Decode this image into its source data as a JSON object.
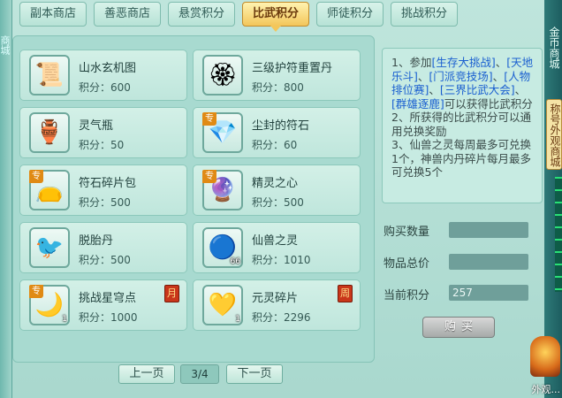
{
  "tabs": [
    {
      "label": "副本商店",
      "active": false
    },
    {
      "label": "善恶商店",
      "active": false
    },
    {
      "label": "悬赏积分",
      "active": false
    },
    {
      "label": "比武积分",
      "active": true
    },
    {
      "label": "师徒积分",
      "active": false
    },
    {
      "label": "挑战积分",
      "active": false
    }
  ],
  "side": {
    "left_text": "商城",
    "right_text": "金币商城",
    "right_tag": "称号外观商城",
    "right_bottom": "外观..."
  },
  "items": [
    {
      "name": "山水玄机图",
      "price": "积分：600",
      "icon": "scroll-icon",
      "glyph": "📜",
      "zhuan": false,
      "count": "",
      "limit": ""
    },
    {
      "name": "三级护符重置丹",
      "price": "积分：800",
      "icon": "talisman-pill-icon",
      "glyph": "🏵",
      "zhuan": false,
      "count": "",
      "limit": ""
    },
    {
      "name": "灵气瓶",
      "price": "积分：50",
      "icon": "bottle-icon",
      "glyph": "🏺",
      "zhuan": false,
      "count": "",
      "limit": ""
    },
    {
      "name": "尘封的符石",
      "price": "积分：60",
      "icon": "rune-stone-icon",
      "glyph": "💎",
      "zhuan": true,
      "zhuan_label": "专",
      "count": "",
      "limit": ""
    },
    {
      "name": "符石碎片包",
      "price": "积分：500",
      "icon": "fragment-bag-icon",
      "glyph": "👝",
      "zhuan": true,
      "zhuan_label": "专",
      "count": "",
      "limit": ""
    },
    {
      "name": "精灵之心",
      "price": "积分：500",
      "icon": "spirit-heart-icon",
      "glyph": "🔮",
      "zhuan": true,
      "zhuan_label": "专",
      "count": "",
      "limit": ""
    },
    {
      "name": "脱胎丹",
      "price": "积分：500",
      "icon": "elixir-icon",
      "glyph": "🐦",
      "zhuan": false,
      "count": "",
      "limit": ""
    },
    {
      "name": "仙兽之灵",
      "price": "积分：1010",
      "icon": "beast-spirit-icon",
      "glyph": "🔵",
      "zhuan": false,
      "count": "66",
      "limit": ""
    },
    {
      "name": "挑战星穹点",
      "price": "积分：1000",
      "icon": "star-moon-icon",
      "glyph": "🌙",
      "zhuan": true,
      "zhuan_label": "专",
      "count": "1",
      "limit": "月"
    },
    {
      "name": "元灵碎片",
      "price": "积分：2296",
      "icon": "spirit-shard-icon",
      "glyph": "💛",
      "zhuan": false,
      "count": "1",
      "limit": "周"
    }
  ],
  "pager": {
    "prev": "上一页",
    "page": "3/4",
    "next": "下一页"
  },
  "info": {
    "p1_prefix": "1、参加",
    "links": [
      "[生存大挑战]",
      "[天地乐斗]",
      "[门派竞技场]",
      "[人物排位赛]",
      "[三界比武大会]",
      "[群雄逐鹿]"
    ],
    "sep": "、",
    "p1_suffix": "可以获得比武积分",
    "p2": "2、所获得的比武积分可以通用兑换奖励",
    "p3": "3、仙兽之灵每周最多可兑换1个，神兽内丹碎片每月最多可兑换5个"
  },
  "form": {
    "qty_label": "购买数量",
    "qty_value": "",
    "total_label": "物品总价",
    "total_value": "",
    "points_label": "当前积分",
    "points_value": "257",
    "buy_label": "购买"
  }
}
